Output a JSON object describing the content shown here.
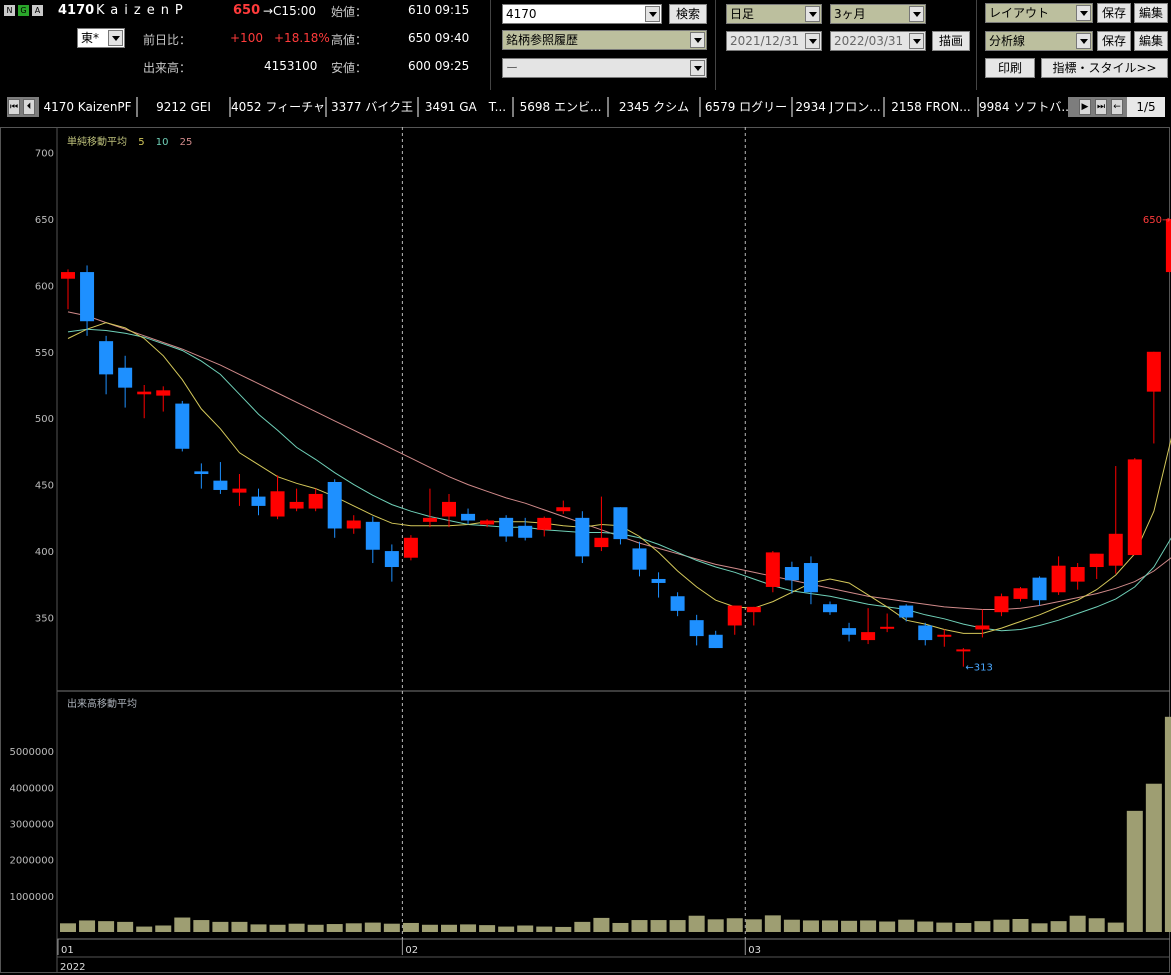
{
  "header": {
    "code": "4170",
    "name": "KaizenP",
    "price": "650",
    "close_time": "→C15:00",
    "market": "東*",
    "change_label": "前日比：",
    "change": "+100",
    "change_pct": "+18.18%",
    "volume_label": "出来高：",
    "volume": "4153100",
    "open_label": "始値：",
    "open": "610 09:15",
    "high_label": "高値：",
    "high": "650 09:40",
    "low_label": "安値：",
    "low": "600 09:25",
    "icons": [
      "N",
      "G",
      "A"
    ]
  },
  "search": {
    "code_value": "4170",
    "search_button": "検索",
    "history_value": "銘柄参照履歴",
    "third_value": "ー"
  },
  "period": {
    "interval": "日足",
    "range": "3ヶ月",
    "from_date": "2021/12/31",
    "to_date": "2022/03/31",
    "draw_button": "描画"
  },
  "layout": {
    "layout_select": "レイアウト",
    "save1": "保存",
    "edit1": "編集",
    "analysis_select": "分析線",
    "save2": "保存",
    "edit2": "編集",
    "print_button": "印刷",
    "style_button": "指標・スタイル>>"
  },
  "tabs": [
    "4170 KaizenPF",
    "9212 GEI",
    "4052 フィーチャ",
    "3377 バイク王",
    "3491 GA　T...",
    "5698 エンビ...",
    "2345 クシム",
    "6579 ログリー",
    "2934 Jフロン...",
    "2158 FRON...",
    "9984 ソフトバ..."
  ],
  "tab_page": "1/5",
  "chart_data": {
    "type": "candlestick",
    "indicator_label": "単純移動平均",
    "ma_periods": [
      "5",
      "10",
      "25"
    ],
    "volume_label": "出来高移動平均",
    "y_ticks": [
      "700",
      "650",
      "600",
      "550",
      "500",
      "450",
      "400",
      "350"
    ],
    "ylim": [
      310,
      705
    ],
    "vol_ticks": [
      "5000000",
      "4000000",
      "3000000",
      "2000000",
      "1000000"
    ],
    "vol_max": 6000000,
    "x_labels": [
      "01",
      "02",
      "03"
    ],
    "x_label_index": [
      0,
      18,
      36
    ],
    "year_label": "2022",
    "high_annotation": "650",
    "low_annotation": "313",
    "up_color": "#ff0000",
    "down_color": "#1e90ff",
    "ma_colors": [
      "#d4c85a",
      "#6fd0b8",
      "#d08a8a"
    ],
    "candles": [
      {
        "o": 605,
        "h": 612,
        "l": 582,
        "c": 610
      },
      {
        "o": 610,
        "h": 615,
        "l": 562,
        "c": 573
      },
      {
        "o": 558,
        "h": 562,
        "l": 518,
        "c": 533
      },
      {
        "o": 538,
        "h": 547,
        "l": 508,
        "c": 523
      },
      {
        "o": 518,
        "h": 525,
        "l": 500,
        "c": 520
      },
      {
        "o": 517,
        "h": 524,
        "l": 505,
        "c": 521
      },
      {
        "o": 511,
        "h": 513,
        "l": 475,
        "c": 477
      },
      {
        "o": 460,
        "h": 466,
        "l": 447,
        "c": 458
      },
      {
        "o": 453,
        "h": 467,
        "l": 443,
        "c": 446
      },
      {
        "o": 444,
        "h": 458,
        "l": 434,
        "c": 447
      },
      {
        "o": 441,
        "h": 447,
        "l": 427,
        "c": 434
      },
      {
        "o": 426,
        "h": 457,
        "l": 424,
        "c": 445
      },
      {
        "o": 432,
        "h": 447,
        "l": 430,
        "c": 437
      },
      {
        "o": 432,
        "h": 447,
        "l": 430,
        "c": 443
      },
      {
        "o": 452,
        "h": 454,
        "l": 410,
        "c": 417
      },
      {
        "o": 417,
        "h": 427,
        "l": 413,
        "c": 423
      },
      {
        "o": 422,
        "h": 426,
        "l": 391,
        "c": 401
      },
      {
        "o": 400,
        "h": 405,
        "l": 377,
        "c": 388
      },
      {
        "o": 395,
        "h": 412,
        "l": 393,
        "c": 410
      },
      {
        "o": 422,
        "h": 447,
        "l": 418,
        "c": 425
      },
      {
        "o": 426,
        "h": 443,
        "l": 418,
        "c": 437
      },
      {
        "o": 428,
        "h": 432,
        "l": 420,
        "c": 423
      },
      {
        "o": 420,
        "h": 424,
        "l": 418,
        "c": 423
      },
      {
        "o": 425,
        "h": 427,
        "l": 407,
        "c": 411
      },
      {
        "o": 419,
        "h": 425,
        "l": 408,
        "c": 410
      },
      {
        "o": 416,
        "h": 426,
        "l": 411,
        "c": 425
      },
      {
        "o": 430,
        "h": 438,
        "l": 428,
        "c": 433
      },
      {
        "o": 425,
        "h": 430,
        "l": 391,
        "c": 396
      },
      {
        "o": 403,
        "h": 441,
        "l": 400,
        "c": 410
      },
      {
        "o": 433,
        "h": 433,
        "l": 405,
        "c": 409
      },
      {
        "o": 402,
        "h": 407,
        "l": 381,
        "c": 386
      },
      {
        "o": 379,
        "h": 384,
        "l": 365,
        "c": 376
      },
      {
        "o": 366,
        "h": 369,
        "l": 351,
        "c": 355
      },
      {
        "o": 348,
        "h": 352,
        "l": 329,
        "c": 336
      },
      {
        "o": 337,
        "h": 340,
        "l": 327,
        "c": 327
      },
      {
        "o": 344,
        "h": 359,
        "l": 337,
        "c": 359
      },
      {
        "o": 354,
        "h": 358,
        "l": 344,
        "c": 358
      },
      {
        "o": 373,
        "h": 400,
        "l": 369,
        "c": 399
      },
      {
        "o": 388,
        "h": 392,
        "l": 368,
        "c": 378
      },
      {
        "o": 391,
        "h": 396,
        "l": 360,
        "c": 369
      },
      {
        "o": 360,
        "h": 362,
        "l": 352,
        "c": 354
      },
      {
        "o": 342,
        "h": 346,
        "l": 332,
        "c": 337
      },
      {
        "o": 333,
        "h": 357,
        "l": 330,
        "c": 339
      },
      {
        "o": 342,
        "h": 353,
        "l": 339,
        "c": 343
      },
      {
        "o": 359,
        "h": 360,
        "l": 347,
        "c": 350
      },
      {
        "o": 344,
        "h": 346,
        "l": 329,
        "c": 333
      },
      {
        "o": 336,
        "h": 341,
        "l": 328,
        "c": 337
      },
      {
        "o": 326,
        "h": 327,
        "l": 313,
        "c": 326
      },
      {
        "o": 341,
        "h": 356,
        "l": 335,
        "c": 344
      },
      {
        "o": 354,
        "h": 368,
        "l": 351,
        "c": 366
      },
      {
        "o": 364,
        "h": 373,
        "l": 362,
        "c": 372
      },
      {
        "o": 380,
        "h": 381,
        "l": 359,
        "c": 363
      },
      {
        "o": 369,
        "h": 396,
        "l": 367,
        "c": 389
      },
      {
        "o": 377,
        "h": 391,
        "l": 371,
        "c": 388
      },
      {
        "o": 388,
        "h": 398,
        "l": 379,
        "c": 398
      },
      {
        "o": 389,
        "h": 464,
        "l": 383,
        "c": 413
      },
      {
        "o": 397,
        "h": 470,
        "l": 397,
        "c": 469
      },
      {
        "o": 520,
        "h": 550,
        "l": 481,
        "c": 550
      },
      {
        "o": 610,
        "h": 650,
        "l": 600,
        "c": 650
      }
    ],
    "volumes": [
      240000,
      320000,
      300000,
      280000,
      150000,
      180000,
      400000,
      330000,
      280000,
      280000,
      210000,
      200000,
      230000,
      200000,
      220000,
      240000,
      260000,
      230000,
      250000,
      200000,
      200000,
      210000,
      190000,
      150000,
      180000,
      150000,
      140000,
      280000,
      390000,
      250000,
      330000,
      330000,
      330000,
      450000,
      350000,
      380000,
      350000,
      460000,
      340000,
      320000,
      320000,
      310000,
      320000,
      290000,
      340000,
      290000,
      260000,
      250000,
      300000,
      340000,
      360000,
      240000,
      300000,
      450000,
      380000,
      260000,
      3350000,
      4100000,
      5950000,
      4153100
    ],
    "ma5": [
      560,
      567,
      572,
      568,
      560,
      547,
      529,
      507,
      492,
      474,
      465,
      456,
      451,
      447,
      441,
      434,
      427,
      421,
      419,
      419,
      419,
      420,
      422,
      422,
      422,
      421,
      419,
      418,
      420,
      419,
      411,
      399,
      385,
      373,
      363,
      358,
      357,
      362,
      369,
      376,
      379,
      376,
      367,
      358,
      348,
      345,
      341,
      338,
      338,
      342,
      347,
      352,
      358,
      363,
      371,
      382,
      398,
      430,
      490
    ],
    "ma10": [
      565,
      567,
      566,
      564,
      561,
      556,
      551,
      543,
      533,
      518,
      503,
      491,
      478,
      469,
      459,
      450,
      442,
      435,
      430,
      426,
      423,
      420,
      419,
      418,
      418,
      416,
      415,
      414,
      414,
      413,
      410,
      405,
      399,
      393,
      388,
      384,
      379,
      374,
      370,
      368,
      366,
      363,
      360,
      358,
      356,
      352,
      349,
      345,
      342,
      340,
      341,
      344,
      348,
      353,
      358,
      364,
      373,
      388,
      412
    ],
    "ma25": [
      580,
      577,
      572,
      567,
      562,
      557,
      552,
      546,
      540,
      533,
      526,
      519,
      512,
      505,
      498,
      491,
      484,
      477,
      470,
      463,
      456,
      450,
      445,
      440,
      436,
      431,
      426,
      421,
      416,
      411,
      406,
      402,
      398,
      394,
      390,
      387,
      384,
      381,
      378,
      375,
      372,
      369,
      366,
      364,
      362,
      360,
      358,
      357,
      356,
      356,
      357,
      359,
      362,
      365,
      368,
      372,
      377,
      385,
      396
    ]
  }
}
